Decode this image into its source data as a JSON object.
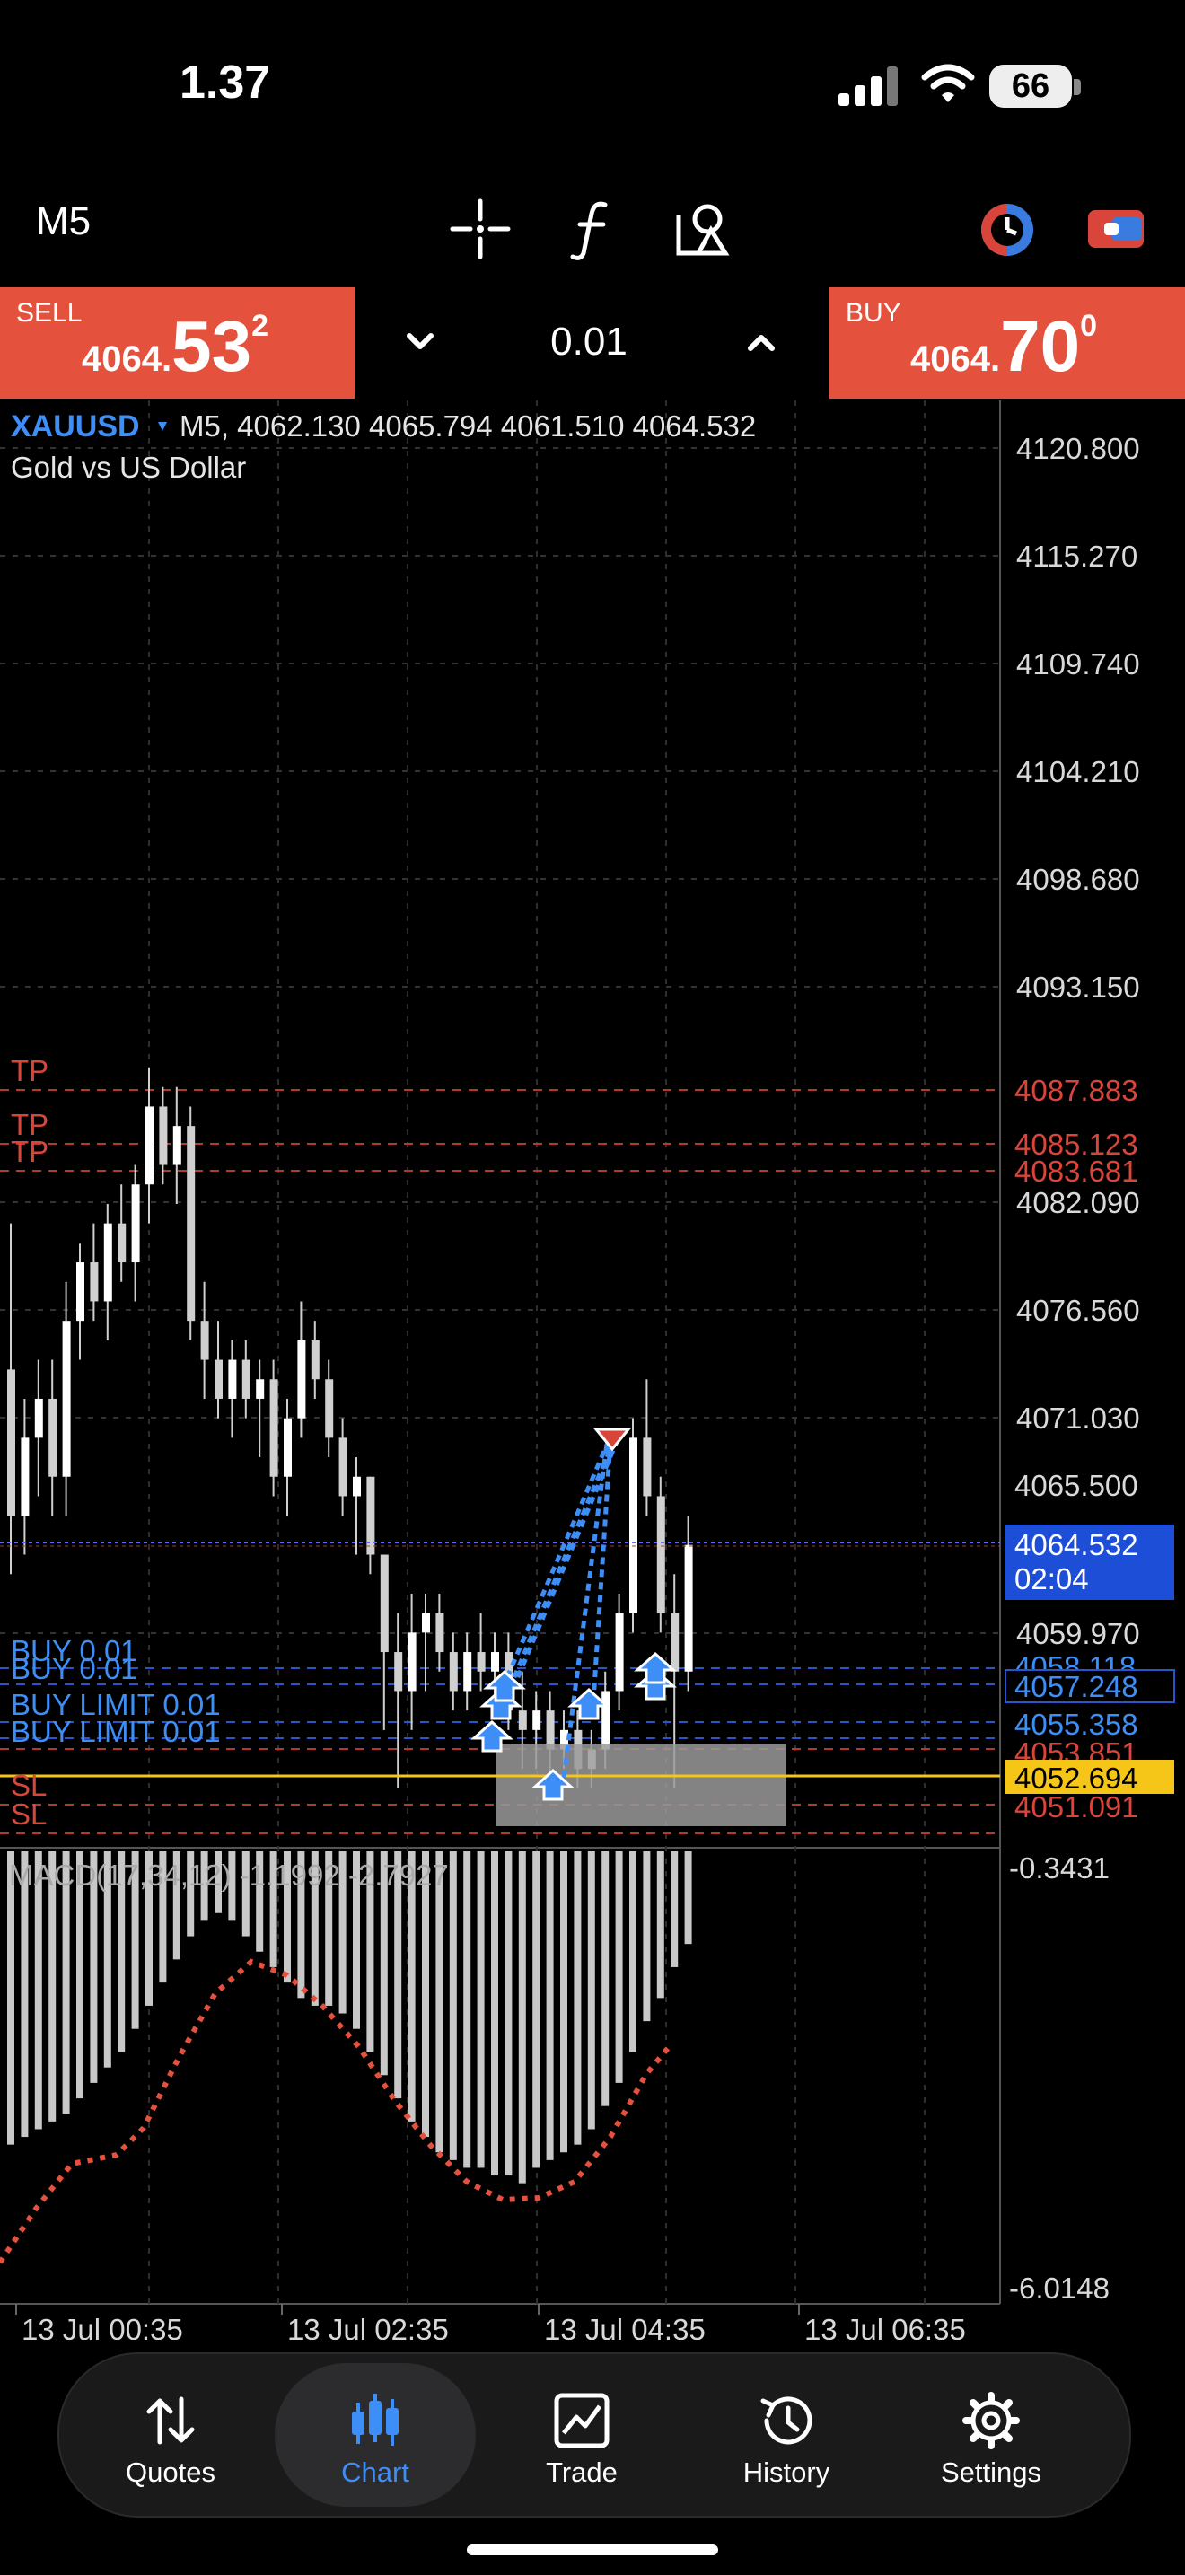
{
  "status_bar": {
    "time": "1.37",
    "battery": "66"
  },
  "toolbar": {
    "timeframe": "M5",
    "icons": [
      "crosshair-icon",
      "function-icon",
      "objects-icon",
      "trade-clock-icon",
      "account-icon"
    ]
  },
  "trade_panel": {
    "sell": {
      "label": "SELL",
      "price_small": "4064.",
      "price_big": "53",
      "price_sup": "2"
    },
    "buy": {
      "label": "BUY",
      "price_small": "4064.",
      "price_big": "70",
      "price_sup": "0"
    },
    "lot_size": "0.01"
  },
  "chart": {
    "symbol": "XAUUSD",
    "header_values": "M5, 4062.130 4065.794 4061.510 4064.532",
    "description": "Gold vs US Dollar",
    "price_axis": [
      "4120.800",
      "4115.270",
      "4109.740",
      "4104.210",
      "4098.680",
      "4093.150",
      "4082.090",
      "4076.560",
      "4071.030",
      "4059.970"
    ],
    "partial_axis": [
      "4065.500",
      "4058.118"
    ],
    "order_labels": {
      "tp": [
        "TP",
        "TP",
        "TP"
      ],
      "tp_prices": [
        "4087.883",
        "4085.123",
        "4083.681"
      ],
      "buy": [
        "BUY 0.01",
        "BUY 0.01",
        "BUY LIMIT 0.01",
        "BUY LIMIT 0.01"
      ],
      "buy_prices": [
        "4057.248",
        "4055.358"
      ],
      "sl": [
        "SL",
        "SL"
      ],
      "sl_prices": [
        "4053.851",
        "4051.091"
      ]
    },
    "current_price": "4064.532",
    "countdown": "02:04",
    "alert_price": "4052.694",
    "macd": {
      "label": "MACD(17,34,12) -1.1992 -2.7927",
      "top": "-0.3431",
      "bottom": "-6.0148"
    },
    "time_axis": [
      "13 Jul 00:35",
      "13 Jul 02:35",
      "13 Jul 04:35",
      "13 Jul 06:35"
    ],
    "colors": {
      "sell": "#e4513c",
      "buy": "#e4513c",
      "accent": "#3d8ef7",
      "tp_sl": "#d9453a",
      "alert": "#f5c518"
    }
  },
  "tabs": [
    {
      "label": "Quotes",
      "icon": "quotes-icon"
    },
    {
      "label": "Chart",
      "icon": "chart-icon"
    },
    {
      "label": "Trade",
      "icon": "trade-icon"
    },
    {
      "label": "History",
      "icon": "history-icon"
    },
    {
      "label": "Settings",
      "icon": "settings-icon"
    }
  ]
}
